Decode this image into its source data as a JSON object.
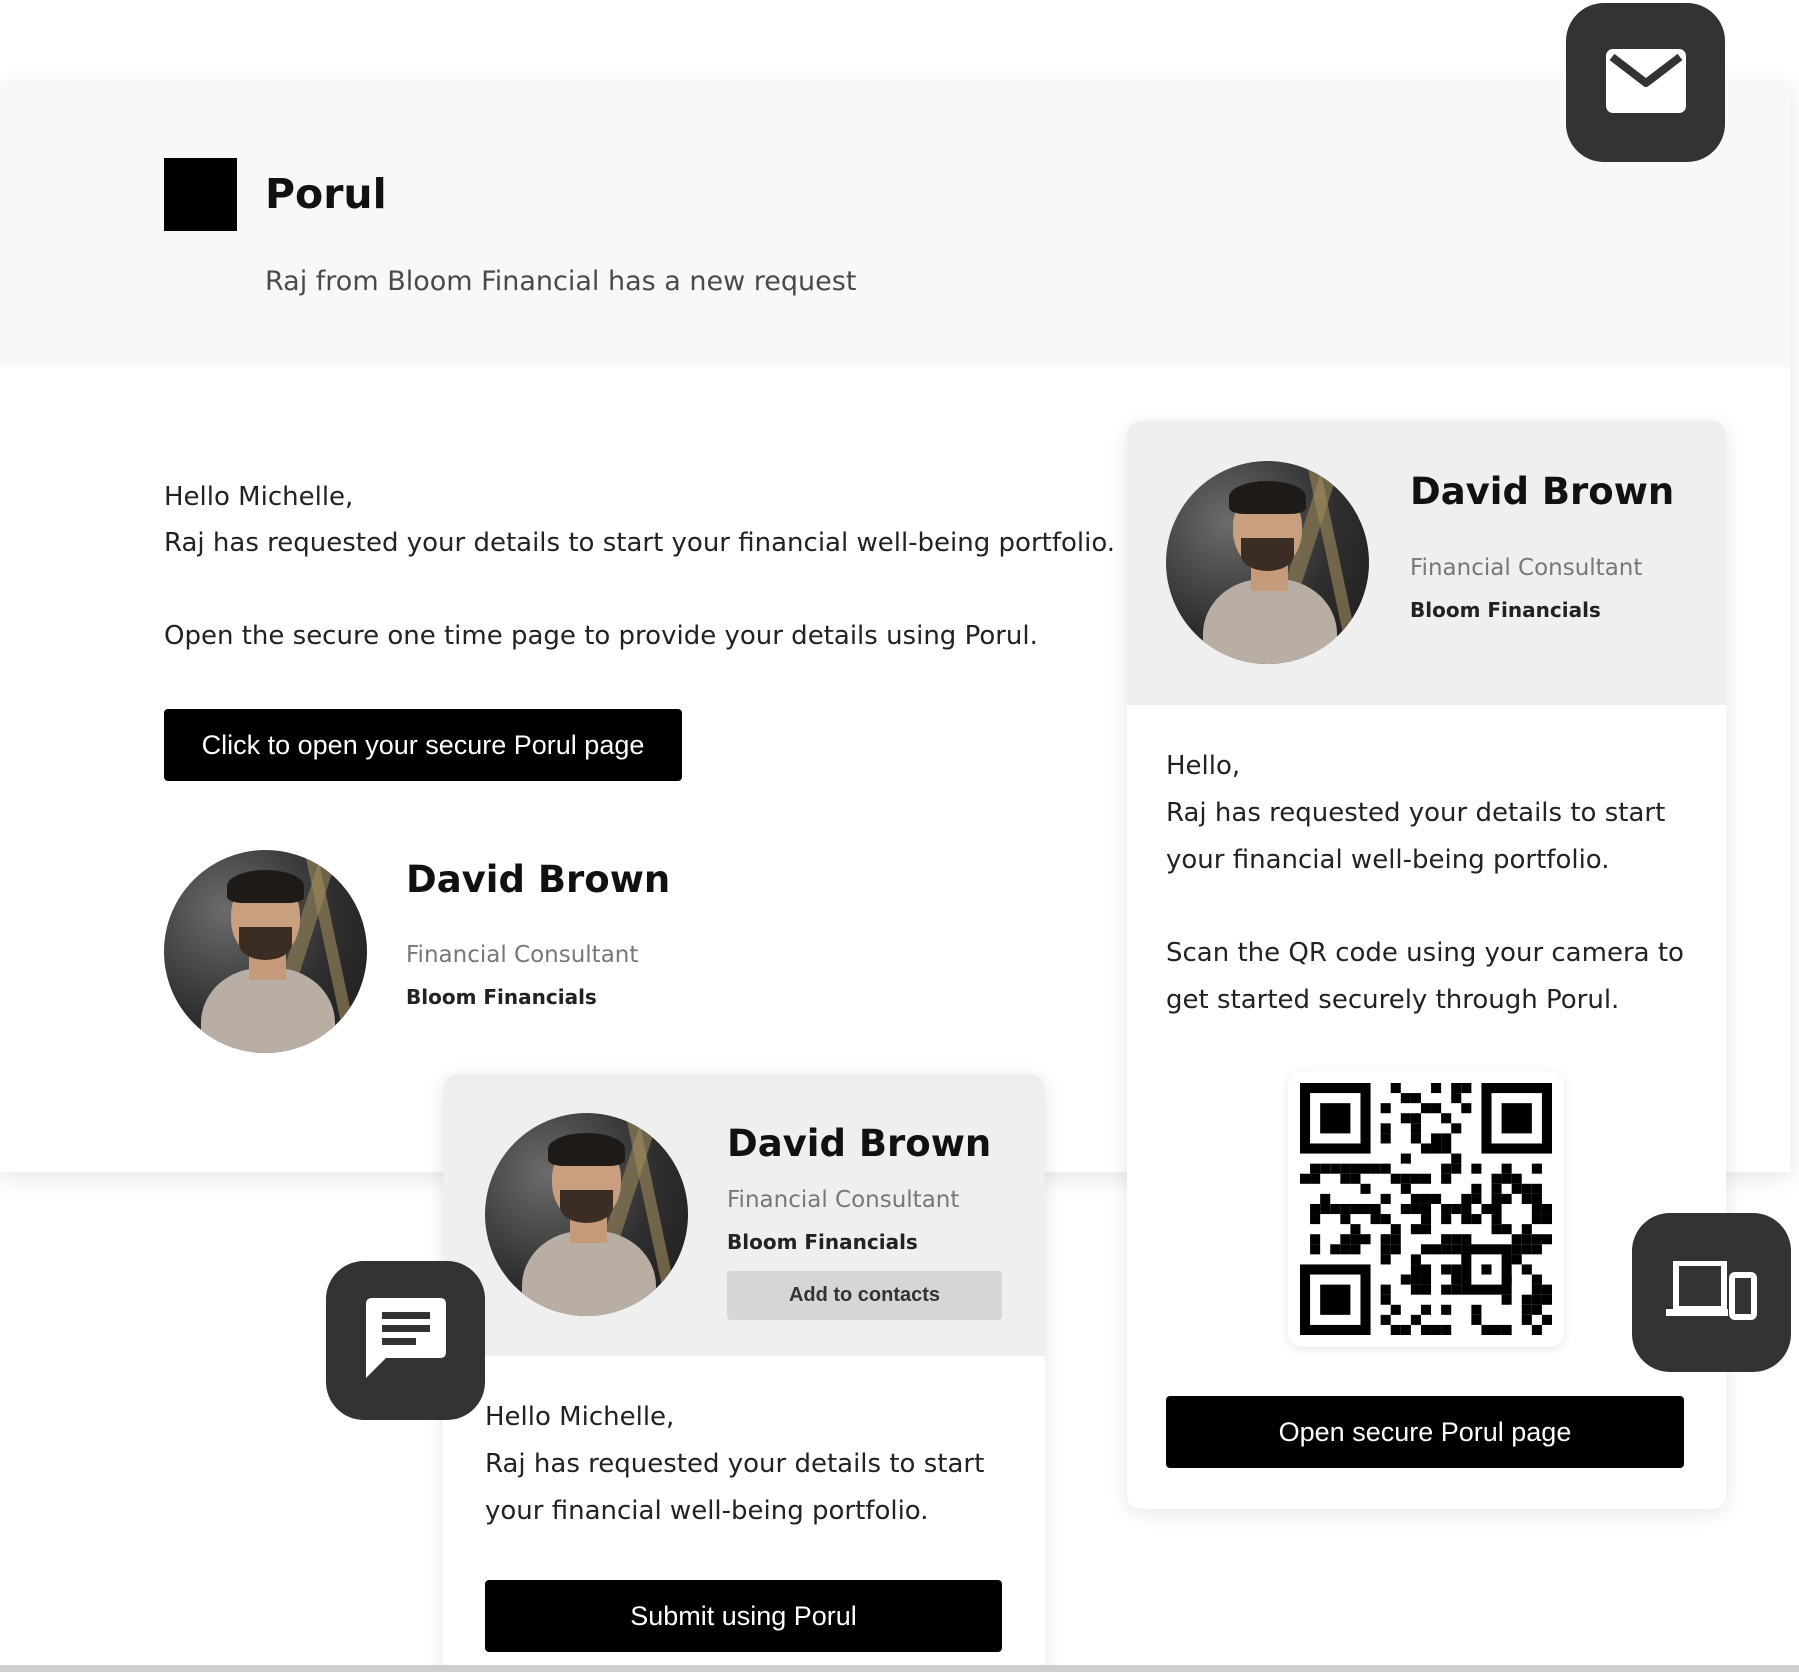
{
  "email": {
    "brand": "Porul",
    "header_subtitle": "Raj from Bloom Financial has a new request",
    "greeting": "Hello Michelle,",
    "line1": "Raj has requested your details to start your financial well-being portfolio.",
    "line2": "Open the secure one time page to provide your details using Porul.",
    "cta_label": "Click to open your secure Porul page",
    "signature": {
      "name": "David Brown",
      "role": "Financial Consultant",
      "company": "Bloom Financials"
    }
  },
  "sms_card": {
    "name": "David Brown",
    "role": "Financial Consultant",
    "company": "Bloom Financials",
    "add_contacts_label": "Add to contacts",
    "greeting": "Hello Michelle,",
    "line1": "Raj has requested your details to start",
    "line2": "your financial well-being portfolio.",
    "cta_label": "Submit using Porul"
  },
  "qr_card": {
    "name": "David Brown",
    "role": "Financial Consultant",
    "company": "Bloom Financials",
    "greeting": "Hello,",
    "line1": "Raj has requested your details to start",
    "line2": "your financial well-being portfolio.",
    "line3": "Scan the QR code using your camera to",
    "line4": "get started securely through Porul.",
    "cta_label": "Open secure Porul page"
  },
  "icons": {
    "mail": "mail-icon",
    "chat": "chat-icon",
    "devices": "devices-icon",
    "qr": "qr-code-icon"
  },
  "colors": {
    "tile": "#333333",
    "button": "#000000",
    "header_bg": "#f8f8f8",
    "card_top_bg": "#efefef"
  }
}
